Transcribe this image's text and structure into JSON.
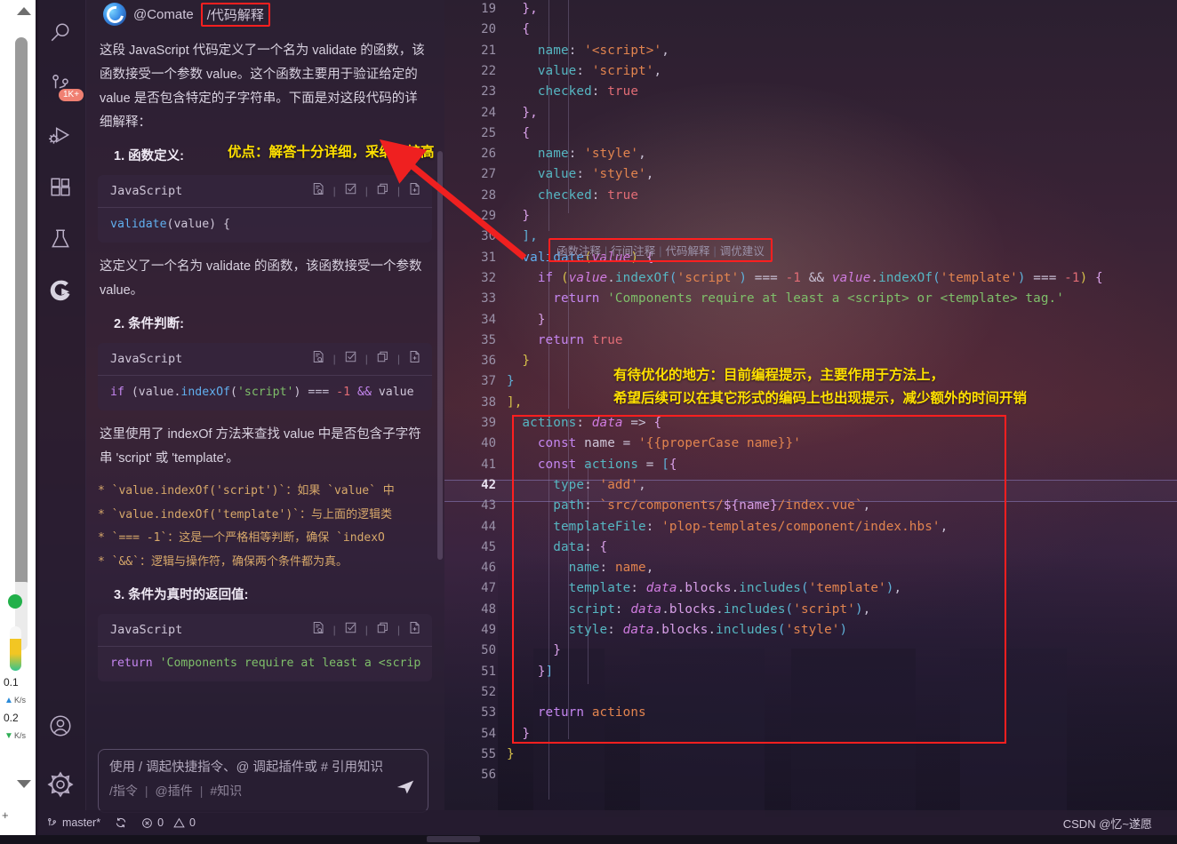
{
  "activity_bar": {
    "items": [
      {
        "name": "search-icon",
        "label": "Search"
      },
      {
        "name": "source-control-icon",
        "label": "Source Control",
        "badge": "1K+"
      },
      {
        "name": "run-and-debug-icon",
        "label": "Run and Debug"
      },
      {
        "name": "extensions-icon",
        "label": "Extensions"
      },
      {
        "name": "testing-icon",
        "label": "Testing"
      },
      {
        "name": "comate-icon",
        "label": "Comate"
      }
    ],
    "bottom_items": [
      {
        "name": "accounts-icon",
        "label": "Accounts"
      },
      {
        "name": "settings-gear-icon",
        "label": "Manage"
      }
    ]
  },
  "chat": {
    "agent_name": "@Comate",
    "command_tag": "/代码解释",
    "paragraph_1": "这段 JavaScript 代码定义了一个名为 validate 的函数，该函数接受一个参数 value。这个函数主要用于验证给定的 value 是否包含特定的子字符串。下面是对这段代码的详细解释：",
    "section_1_title": "1. 函数定义:",
    "code_block_1": {
      "language": "JavaScript",
      "code": "validate(value) {"
    },
    "paragraph_2": "这定义了一个名为 validate 的函数，该函数接受一个参数 value。",
    "section_2_title": "2. 条件判断:",
    "code_block_2": {
      "language": "JavaScript",
      "code": "if (value.indexOf('script') === -1 && value"
    },
    "paragraph_3": "这里使用了 indexOf 方法来查找 value 中是否包含子字符串 'script' 或 'template'。",
    "bullets": [
      "* `value.indexOf('script')`：如果 `value` 中",
      "* `value.indexOf('template')`：与上面的逻辑类",
      "* `=== -1`：这是一个严格相等判断，确保 `indexO",
      "* `&&`：逻辑与操作符，确保两个条件都为真。"
    ],
    "section_3_title": "3. 条件为真时的返回值:",
    "code_block_3": {
      "language": "JavaScript",
      "code": "return 'Components require at least a <scrip"
    },
    "code_card_actions": [
      "preview-icon",
      "check-icon",
      "copy-icon",
      "insert-file-icon"
    ],
    "input": {
      "placeholder": "使用 / 调起快捷指令、@ 调起插件或 # 引用知识",
      "chips": [
        "/指令",
        "@插件",
        "#知识"
      ],
      "send_icon": "send-icon"
    }
  },
  "editor": {
    "first_line_number": 19,
    "active_line": 42,
    "codelens": [
      "函数注释",
      "行间注释",
      "代码解释",
      "调优建议"
    ],
    "lines": [
      {
        "n": 19,
        "tokens": [
          {
            "t": "  ",
            "c": "t-plain"
          },
          {
            "t": "},",
            "c": "t-punc"
          }
        ]
      },
      {
        "n": 20,
        "tokens": [
          {
            "t": "  ",
            "c": "t-plain"
          },
          {
            "t": "{",
            "c": "t-punc"
          }
        ]
      },
      {
        "n": 21,
        "tokens": [
          {
            "t": "    ",
            "c": "t-plain"
          },
          {
            "t": "name",
            "c": "t-prop"
          },
          {
            "t": ": ",
            "c": "t-op"
          },
          {
            "t": "'<script>'",
            "c": "t-str"
          },
          {
            "t": ",",
            "c": "t-op"
          }
        ]
      },
      {
        "n": 22,
        "tokens": [
          {
            "t": "    ",
            "c": "t-plain"
          },
          {
            "t": "value",
            "c": "t-prop"
          },
          {
            "t": ": ",
            "c": "t-op"
          },
          {
            "t": "'script'",
            "c": "t-str"
          },
          {
            "t": ",",
            "c": "t-op"
          }
        ]
      },
      {
        "n": 23,
        "tokens": [
          {
            "t": "    ",
            "c": "t-plain"
          },
          {
            "t": "checked",
            "c": "t-prop"
          },
          {
            "t": ": ",
            "c": "t-op"
          },
          {
            "t": "true",
            "c": "t-kw2"
          }
        ]
      },
      {
        "n": 24,
        "tokens": [
          {
            "t": "  ",
            "c": "t-plain"
          },
          {
            "t": "},",
            "c": "t-punc"
          }
        ]
      },
      {
        "n": 25,
        "tokens": [
          {
            "t": "  ",
            "c": "t-plain"
          },
          {
            "t": "{",
            "c": "t-punc"
          }
        ]
      },
      {
        "n": 26,
        "tokens": [
          {
            "t": "    ",
            "c": "t-plain"
          },
          {
            "t": "name",
            "c": "t-prop"
          },
          {
            "t": ": ",
            "c": "t-op"
          },
          {
            "t": "'style'",
            "c": "t-str"
          },
          {
            "t": ",",
            "c": "t-op"
          }
        ]
      },
      {
        "n": 27,
        "tokens": [
          {
            "t": "    ",
            "c": "t-plain"
          },
          {
            "t": "value",
            "c": "t-prop"
          },
          {
            "t": ": ",
            "c": "t-op"
          },
          {
            "t": "'style'",
            "c": "t-str"
          },
          {
            "t": ",",
            "c": "t-op"
          }
        ]
      },
      {
        "n": 28,
        "tokens": [
          {
            "t": "    ",
            "c": "t-plain"
          },
          {
            "t": "checked",
            "c": "t-prop"
          },
          {
            "t": ": ",
            "c": "t-op"
          },
          {
            "t": "true",
            "c": "t-kw2"
          }
        ]
      },
      {
        "n": 29,
        "tokens": [
          {
            "t": "  ",
            "c": "t-plain"
          },
          {
            "t": "}",
            "c": "t-punc"
          }
        ]
      },
      {
        "n": 30,
        "tokens": [
          {
            "t": "  ",
            "c": "t-plain"
          },
          {
            "t": "],",
            "c": "t-punc2"
          }
        ]
      },
      {
        "n": 31,
        "tokens": [
          {
            "t": "  ",
            "c": "t-plain"
          },
          {
            "t": "validate",
            "c": "t-fn"
          },
          {
            "t": "(",
            "c": "t-punc3"
          },
          {
            "t": "value",
            "c": "t-var"
          },
          {
            "t": ")",
            "c": "t-punc3"
          },
          {
            "t": " ",
            "c": "t-op"
          },
          {
            "t": "{",
            "c": "t-punc"
          }
        ]
      },
      {
        "n": 32,
        "tokens": [
          {
            "t": "    ",
            "c": "t-plain"
          },
          {
            "t": "if",
            "c": "t-key"
          },
          {
            "t": " ",
            "c": "t-op"
          },
          {
            "t": "(",
            "c": "t-punc3"
          },
          {
            "t": "value",
            "c": "t-var"
          },
          {
            "t": ".",
            "c": "t-op"
          },
          {
            "t": "indexOf",
            "c": "t-prop"
          },
          {
            "t": "(",
            "c": "t-punc2"
          },
          {
            "t": "'script'",
            "c": "t-str"
          },
          {
            "t": ")",
            "c": "t-punc2"
          },
          {
            "t": " === ",
            "c": "t-op"
          },
          {
            "t": "-1",
            "c": "t-num"
          },
          {
            "t": " ",
            "c": "t-op"
          },
          {
            "t": "&&",
            "c": "t-op"
          },
          {
            "t": " ",
            "c": "t-op"
          },
          {
            "t": "value",
            "c": "t-var"
          },
          {
            "t": ".",
            "c": "t-op"
          },
          {
            "t": "indexOf",
            "c": "t-prop"
          },
          {
            "t": "(",
            "c": "t-punc2"
          },
          {
            "t": "'template'",
            "c": "t-str"
          },
          {
            "t": ")",
            "c": "t-punc2"
          },
          {
            "t": " === ",
            "c": "t-op"
          },
          {
            "t": "-1",
            "c": "t-num"
          },
          {
            "t": ")",
            "c": "t-punc3"
          },
          {
            "t": " ",
            "c": "t-op"
          },
          {
            "t": "{",
            "c": "t-punc"
          }
        ]
      },
      {
        "n": 33,
        "tokens": [
          {
            "t": "      ",
            "c": "t-plain"
          },
          {
            "t": "return",
            "c": "t-key"
          },
          {
            "t": " ",
            "c": "t-op"
          },
          {
            "t": "'Components require at least a <script> or <template> tag.'",
            "c": "t-str2"
          }
        ]
      },
      {
        "n": 34,
        "tokens": [
          {
            "t": "    ",
            "c": "t-plain"
          },
          {
            "t": "}",
            "c": "t-punc"
          }
        ]
      },
      {
        "n": 35,
        "tokens": [
          {
            "t": "    ",
            "c": "t-plain"
          },
          {
            "t": "return",
            "c": "t-key"
          },
          {
            "t": " ",
            "c": "t-op"
          },
          {
            "t": "true",
            "c": "t-kw2"
          }
        ]
      },
      {
        "n": 36,
        "tokens": [
          {
            "t": "  ",
            "c": "t-plain"
          },
          {
            "t": "}",
            "c": "t-punc3"
          }
        ]
      },
      {
        "n": 37,
        "tokens": [
          {
            "t": "",
            "c": "t-plain"
          },
          {
            "t": "}",
            "c": "t-punc2"
          }
        ]
      },
      {
        "n": 38,
        "tokens": [
          {
            "t": "",
            "c": "t-plain"
          },
          {
            "t": "],",
            "c": "t-punc3"
          }
        ]
      },
      {
        "n": 39,
        "tokens": [
          {
            "t": "  ",
            "c": "t-plain"
          },
          {
            "t": "actions",
            "c": "t-prop"
          },
          {
            "t": ": ",
            "c": "t-op"
          },
          {
            "t": "data",
            "c": "t-var"
          },
          {
            "t": " => ",
            "c": "t-op"
          },
          {
            "t": "{",
            "c": "t-punc"
          }
        ]
      },
      {
        "n": 40,
        "tokens": [
          {
            "t": "    ",
            "c": "t-plain"
          },
          {
            "t": "const",
            "c": "t-key"
          },
          {
            "t": " ",
            "c": "t-op"
          },
          {
            "t": "name",
            "c": "t-plain"
          },
          {
            "t": " = ",
            "c": "t-op"
          },
          {
            "t": "'{{properCase name}}'",
            "c": "t-str"
          }
        ]
      },
      {
        "n": 41,
        "tokens": [
          {
            "t": "    ",
            "c": "t-plain"
          },
          {
            "t": "const",
            "c": "t-key"
          },
          {
            "t": " ",
            "c": "t-op"
          },
          {
            "t": "actions",
            "c": "t-prop"
          },
          {
            "t": " = ",
            "c": "t-op"
          },
          {
            "t": "[",
            "c": "t-punc2"
          },
          {
            "t": "{",
            "c": "t-punc"
          }
        ]
      },
      {
        "n": 42,
        "tokens": [
          {
            "t": "      ",
            "c": "t-plain"
          },
          {
            "t": "type",
            "c": "t-prop"
          },
          {
            "t": ": ",
            "c": "t-op"
          },
          {
            "t": "'add'",
            "c": "t-str"
          },
          {
            "t": ",",
            "c": "t-op"
          }
        ]
      },
      {
        "n": 43,
        "tokens": [
          {
            "t": "      ",
            "c": "t-plain"
          },
          {
            "t": "path",
            "c": "t-prop"
          },
          {
            "t": ": ",
            "c": "t-op"
          },
          {
            "t": "`src/components/",
            "c": "t-str"
          },
          {
            "t": "${name}",
            "c": "t-punc"
          },
          {
            "t": "/index.vue`",
            "c": "t-str"
          },
          {
            "t": ",",
            "c": "t-op"
          }
        ]
      },
      {
        "n": 44,
        "tokens": [
          {
            "t": "      ",
            "c": "t-plain"
          },
          {
            "t": "templateFile",
            "c": "t-prop"
          },
          {
            "t": ": ",
            "c": "t-op"
          },
          {
            "t": "'plop-templates/component/index.hbs'",
            "c": "t-str"
          },
          {
            "t": ",",
            "c": "t-op"
          }
        ]
      },
      {
        "n": 45,
        "tokens": [
          {
            "t": "      ",
            "c": "t-plain"
          },
          {
            "t": "data",
            "c": "t-prop"
          },
          {
            "t": ": ",
            "c": "t-op"
          },
          {
            "t": "{",
            "c": "t-punc"
          }
        ]
      },
      {
        "n": 46,
        "tokens": [
          {
            "t": "        ",
            "c": "t-plain"
          },
          {
            "t": "name",
            "c": "t-prop"
          },
          {
            "t": ": ",
            "c": "t-op"
          },
          {
            "t": "name",
            "c": "t-str"
          },
          {
            "t": ",",
            "c": "t-op"
          }
        ]
      },
      {
        "n": 47,
        "tokens": [
          {
            "t": "        ",
            "c": "t-plain"
          },
          {
            "t": "template",
            "c": "t-prop"
          },
          {
            "t": ": ",
            "c": "t-op"
          },
          {
            "t": "data",
            "c": "t-var"
          },
          {
            "t": ".",
            "c": "t-op"
          },
          {
            "t": "blocks",
            "c": "t-punc"
          },
          {
            "t": ".",
            "c": "t-op"
          },
          {
            "t": "includes",
            "c": "t-prop"
          },
          {
            "t": "(",
            "c": "t-punc2"
          },
          {
            "t": "'template'",
            "c": "t-str"
          },
          {
            "t": ")",
            "c": "t-punc2"
          },
          {
            "t": ",",
            "c": "t-op"
          }
        ]
      },
      {
        "n": 48,
        "tokens": [
          {
            "t": "        ",
            "c": "t-plain"
          },
          {
            "t": "script",
            "c": "t-prop"
          },
          {
            "t": ": ",
            "c": "t-op"
          },
          {
            "t": "data",
            "c": "t-var"
          },
          {
            "t": ".",
            "c": "t-op"
          },
          {
            "t": "blocks",
            "c": "t-punc"
          },
          {
            "t": ".",
            "c": "t-op"
          },
          {
            "t": "includes",
            "c": "t-prop"
          },
          {
            "t": "(",
            "c": "t-punc2"
          },
          {
            "t": "'script'",
            "c": "t-str"
          },
          {
            "t": ")",
            "c": "t-punc2"
          },
          {
            "t": ",",
            "c": "t-op"
          }
        ]
      },
      {
        "n": 49,
        "tokens": [
          {
            "t": "        ",
            "c": "t-plain"
          },
          {
            "t": "style",
            "c": "t-prop"
          },
          {
            "t": ": ",
            "c": "t-op"
          },
          {
            "t": "data",
            "c": "t-var"
          },
          {
            "t": ".",
            "c": "t-op"
          },
          {
            "t": "blocks",
            "c": "t-punc"
          },
          {
            "t": ".",
            "c": "t-op"
          },
          {
            "t": "includes",
            "c": "t-prop"
          },
          {
            "t": "(",
            "c": "t-punc2"
          },
          {
            "t": "'style'",
            "c": "t-str"
          },
          {
            "t": ")",
            "c": "t-punc2"
          }
        ]
      },
      {
        "n": 50,
        "tokens": [
          {
            "t": "      ",
            "c": "t-plain"
          },
          {
            "t": "}",
            "c": "t-punc"
          }
        ]
      },
      {
        "n": 51,
        "tokens": [
          {
            "t": "    ",
            "c": "t-plain"
          },
          {
            "t": "}",
            "c": "t-punc"
          },
          {
            "t": "]",
            "c": "t-punc2"
          }
        ]
      },
      {
        "n": 52,
        "tokens": [
          {
            "t": "",
            "c": "t-plain"
          }
        ]
      },
      {
        "n": 53,
        "tokens": [
          {
            "t": "    ",
            "c": "t-plain"
          },
          {
            "t": "return",
            "c": "t-key"
          },
          {
            "t": " ",
            "c": "t-op"
          },
          {
            "t": "actions",
            "c": "t-str"
          }
        ]
      },
      {
        "n": 54,
        "tokens": [
          {
            "t": "  ",
            "c": "t-plain"
          },
          {
            "t": "}",
            "c": "t-punc"
          }
        ]
      },
      {
        "n": 55,
        "tokens": [
          {
            "t": "",
            "c": "t-plain"
          },
          {
            "t": "}",
            "c": "t-punc3"
          }
        ]
      },
      {
        "n": 56,
        "tokens": []
      }
    ]
  },
  "annotations": {
    "pros": "优点：解答十分详细，采纳率较高",
    "cons_line_1": "有待优化的地方：目前编程提示，主要作用于方法上，",
    "cons_line_2": "希望后续可以在其它形式的编码上也出现提示，减少额外的时间开销"
  },
  "status_bar": {
    "branch": "master*",
    "sync_icon": "sync-icon",
    "errors": "0",
    "warnings": "0",
    "watermark": "CSDN @忆~遂愿"
  },
  "net_widget": {
    "upload": "0.1",
    "upload_unit": "K/s",
    "download": "0.2",
    "download_unit": "K/s"
  },
  "colors": {
    "annotation_yellow": "#ffe000",
    "highlight_red": "#ff1f1f",
    "badge_red": "#f08072",
    "status_green": "#22b04a"
  }
}
